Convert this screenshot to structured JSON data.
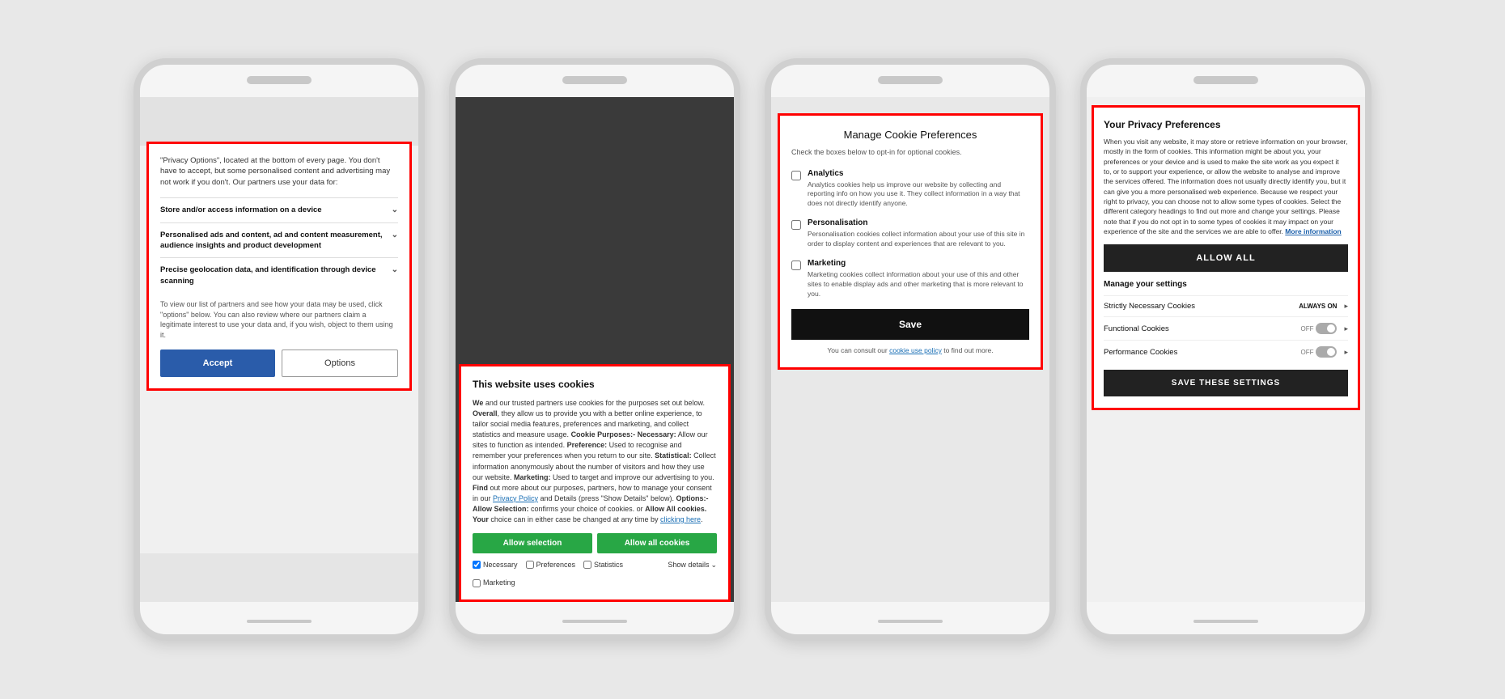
{
  "phone1": {
    "intro_text": "\"Privacy Options\", located at the bottom of every page. You don't have to accept, but some personalised content and advertising may not work if you don't. Our partners use your data for:",
    "items": [
      {
        "label": "Store and/or access information on a device"
      },
      {
        "label": "Personalised ads and content, ad and content measurement, audience insights and product development"
      },
      {
        "label": "Precise geolocation data, and identification through device scanning"
      }
    ],
    "footer_text": "To view our list of partners and see how your data may be used, click \"options\" below. You can also review where our partners claim a legitimate interest to use your data and, if you wish, object to them using it.",
    "accept_label": "Accept",
    "options_label": "Options"
  },
  "phone2": {
    "title": "This website uses cookies",
    "body": "We and our trusted partners use cookies for the purposes set out below. Overall, they allow us to provide you with a better online experience, to tailor social media features, preferences and marketing, and collect statistics and measure usage. Cookie Purposes:- Necessary: Allow our sites to function as intended. Preference: Used to recognise and remember your preferences when you return to our site. Statistical: Collect information anonymously about the number of visitors and how they use our website. Marketing: Used to target and improve our advertising to you. Find out more about our purposes, partners, how to manage your consent in our Privacy Policy and Details (press \"Show Details\" below). Options:- Allow Selection: confirms your choice of cookies. or Allow All cookies. Your choice can in either case be changed at any time by clicking here.",
    "privacy_policy_link": "Privacy Policy",
    "clicking_here_link": "clicking here",
    "allow_selection_label": "Allow selection",
    "allow_all_label": "Allow all cookies",
    "checkboxes": [
      {
        "label": "Necessary",
        "checked": true
      },
      {
        "label": "Preferences",
        "checked": false
      },
      {
        "label": "Statistics",
        "checked": false
      },
      {
        "label": "Marketing",
        "checked": false
      }
    ],
    "show_details_label": "Show details"
  },
  "phone3": {
    "title": "Manage Cookie Preferences",
    "subtitle": "Check the boxes below to opt-in for optional cookies.",
    "options": [
      {
        "label": "Analytics",
        "desc": "Analytics cookies help us improve our website by collecting and reporting info on how you use it. They collect information in a way that does not directly identify anyone.",
        "checked": false
      },
      {
        "label": "Personalisation",
        "desc": "Personalisation cookies collect information about your use of this site in order to display content and experiences that are relevant to you.",
        "checked": false
      },
      {
        "label": "Marketing",
        "desc": "Marketing cookies collect information about your use of this and other sites to enable display ads and other marketing that is more relevant to you.",
        "checked": false
      }
    ],
    "save_label": "Save",
    "consult_text": "You can consult our",
    "cookie_policy_link": "cookie use policy",
    "consult_text2": "to find out more."
  },
  "phone4": {
    "title": "Your Privacy Preferences",
    "body": "When you visit any website, it may store or retrieve information on your browser, mostly in the form of cookies. This information might be about you, your preferences or your device and is used to make the site work as you expect it to, or to support your experience, or allow the website to analyse and improve the services offered. The information does not usually directly identify you, but it can give you a more personalised web experience. Because we respect your right to privacy, you can choose not to allow some types of cookies. Select the different category headings to find out more and change your settings. Please note that if you do not opt in to some types of cookies it may impact on your experience of the site and the services we are able to offer.",
    "more_info_link": "More information",
    "allow_all_label": "ALLOW ALL",
    "manage_title": "Manage your settings",
    "cookies": [
      {
        "name": "Strictly Necessary Cookies",
        "status": "ALWAYS ON",
        "type": "always"
      },
      {
        "name": "Functional Cookies",
        "status": "OFF",
        "type": "toggle"
      },
      {
        "name": "Performance Cookies",
        "status": "OFF",
        "type": "toggle"
      }
    ],
    "save_settings_label": "SAVE THESE SETTINGS"
  }
}
